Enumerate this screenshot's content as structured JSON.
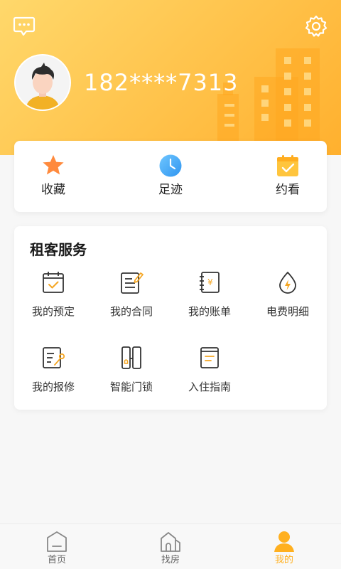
{
  "colors": {
    "accent": "#ffb020",
    "header_gradient_start": "#ffd86b",
    "header_gradient_end": "#ffb02e",
    "text_primary": "#222222",
    "tab_inactive": "#666666"
  },
  "header": {
    "phone_number": "182****7313",
    "message_icon": "message-icon",
    "settings_icon": "gear-icon",
    "avatar_icon": "avatar-icon"
  },
  "quick_actions": [
    {
      "label": "收藏",
      "icon": "star-icon"
    },
    {
      "label": "足迹",
      "icon": "clock-icon"
    },
    {
      "label": "约看",
      "icon": "calendar-check-icon"
    }
  ],
  "services": {
    "title": "租客服务",
    "items": [
      {
        "label": "我的预定",
        "icon": "calendar-check-icon"
      },
      {
        "label": "我的合同",
        "icon": "contract-icon"
      },
      {
        "label": "我的账单",
        "icon": "bill-icon"
      },
      {
        "label": "电费明细",
        "icon": "electricity-icon"
      },
      {
        "label": "我的报修",
        "icon": "repair-icon"
      },
      {
        "label": "智能门锁",
        "icon": "smart-lock-icon"
      },
      {
        "label": "入住指南",
        "icon": "guide-book-icon"
      }
    ]
  },
  "tabbar": {
    "tabs": [
      {
        "label": "首页",
        "icon": "home-icon",
        "active": false
      },
      {
        "label": "找房",
        "icon": "house-search-icon",
        "active": false
      },
      {
        "label": "我的",
        "icon": "user-icon",
        "active": true
      }
    ]
  }
}
